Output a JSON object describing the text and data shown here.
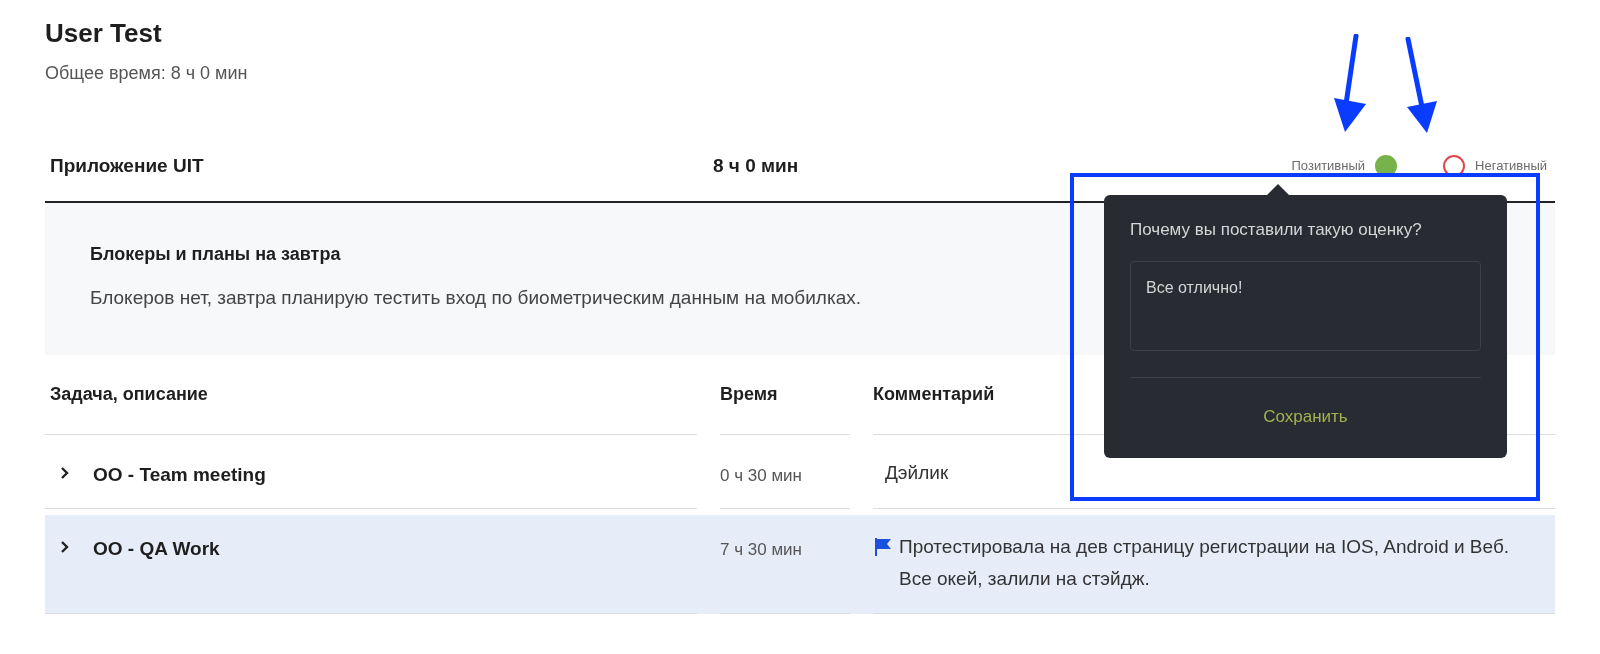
{
  "title": "User Test",
  "total_time": "Общее время: 8 ч 0 мин",
  "project": {
    "name": "Приложение UIT",
    "time": "8 ч 0 мин"
  },
  "ratings": [
    {
      "label": "Позитивный",
      "selected": true,
      "color": "#78b24a"
    },
    {
      "label": "Негативный",
      "selected": false,
      "color": "#e0474c"
    }
  ],
  "notes": {
    "title": "Блокеры и планы на завтра",
    "text": "Блокеров нет, завтра планирую тестить вход по биометрическим данным на мобилках."
  },
  "table": {
    "columns": [
      "Задача, описание",
      "Время",
      "Комментарий"
    ],
    "rows": [
      {
        "task": "OO - Team meeting",
        "time": "0 ч 30 мин",
        "comment": "Дэйлик",
        "flagged": false,
        "selected": false
      },
      {
        "task": "OO - QA Work",
        "time": "7 ч 30 мин",
        "comment": "Протестировала на дев страницу регистрации на IOS, Android и Веб. Все окей, залили на стэйдж.",
        "flagged": true,
        "selected": true
      }
    ]
  },
  "popup": {
    "question": "Почему вы поставили такую оценку?",
    "answer": "Все отлично!",
    "save": "Сохранить"
  }
}
